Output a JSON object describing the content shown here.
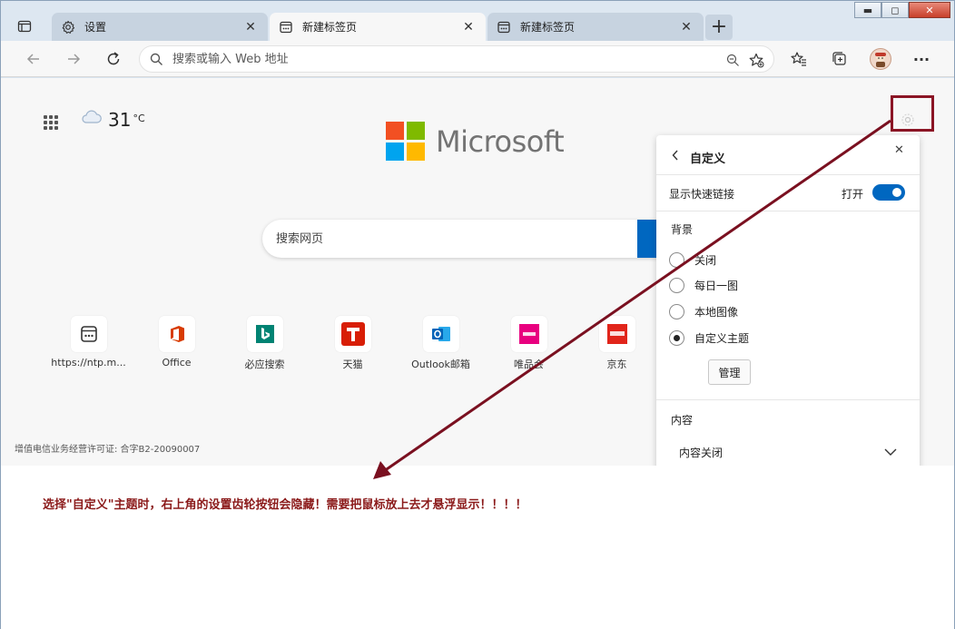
{
  "tabs": [
    {
      "label": "设置",
      "icon": "gear-icon",
      "active": false
    },
    {
      "label": "新建标签页",
      "icon": "newtab-page-icon",
      "active": true
    },
    {
      "label": "新建标签页",
      "icon": "newtab-page-icon",
      "active": false
    }
  ],
  "addressbar": {
    "placeholder": "搜索或输入 Web 地址"
  },
  "weather": {
    "temp": "31",
    "unit": "°C"
  },
  "brand": {
    "name": "Microsoft",
    "colors": [
      "#f25022",
      "#7fba00",
      "#00a4ef",
      "#ffb900"
    ]
  },
  "search": {
    "placeholder": "搜索网页"
  },
  "quicklinks": [
    {
      "label": "https://ntp.m...",
      "icon": "ntp-icon"
    },
    {
      "label": "Office",
      "icon": "office-icon"
    },
    {
      "label": "必应搜索",
      "icon": "bing-icon"
    },
    {
      "label": "天猫",
      "icon": "tmall-icon"
    },
    {
      "label": "Outlook邮箱",
      "icon": "outlook-icon"
    },
    {
      "label": "唯品会",
      "icon": "vip-icon"
    },
    {
      "label": "京东",
      "icon": "jd-icon"
    }
  ],
  "license": "增值电信业务经营许可证: 合字B2-20090007",
  "panel": {
    "title": "自定义",
    "quick_links_label": "显示快速链接",
    "quick_links_state": "打开",
    "background_label": "背景",
    "options": [
      {
        "label": "关闭",
        "selected": false
      },
      {
        "label": "每日一图",
        "selected": false
      },
      {
        "label": "本地图像",
        "selected": false
      },
      {
        "label": "自定义主题",
        "selected": true
      }
    ],
    "manage_label": "管理",
    "content_label": "内容",
    "content_value": "内容关闭"
  },
  "annotation": "选择\"自定义\"主题时，右上角的设置齿轮按钮会隐藏！需要把鼠标放上去才悬浮显示！！！！",
  "colors": {
    "accent": "#0067c0",
    "annotation": "#8b1a1a"
  }
}
